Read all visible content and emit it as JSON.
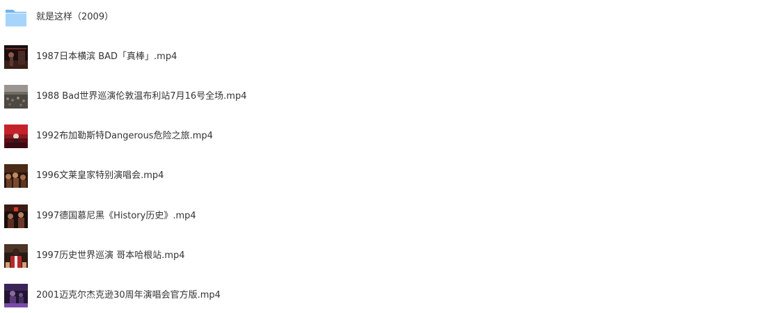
{
  "files": [
    {
      "name": "就是这样（2009）",
      "icon": "folder-icon",
      "type": "folder"
    },
    {
      "name": "1987日本横滨 BAD「真棒」.mp4",
      "icon": "video-thumbnail-icon",
      "type": "video"
    },
    {
      "name": "1988 Bad世界巡演伦敦温布利站7月16号全场.mp4",
      "icon": "video-thumbnail-icon",
      "type": "video"
    },
    {
      "name": "1992布加勒斯特Dangerous危险之旅.mp4",
      "icon": "video-thumbnail-icon",
      "type": "video"
    },
    {
      "name": "1996文莱皇家特别演唱会.mp4",
      "icon": "video-thumbnail-icon",
      "type": "video"
    },
    {
      "name": "1997德国慕尼黑《History历史》.mp4",
      "icon": "video-thumbnail-icon",
      "type": "video"
    },
    {
      "name": "1997历史世界巡演 哥本哈根站.mp4",
      "icon": "video-thumbnail-icon",
      "type": "video"
    },
    {
      "name": "2001迈克尔杰克逊30周年演唱会官方版.mp4",
      "icon": "video-thumbnail-icon",
      "type": "video"
    }
  ],
  "colors": {
    "folder_front": "#9fd0fb",
    "folder_back": "#6fb3f0",
    "text": "#333333"
  }
}
